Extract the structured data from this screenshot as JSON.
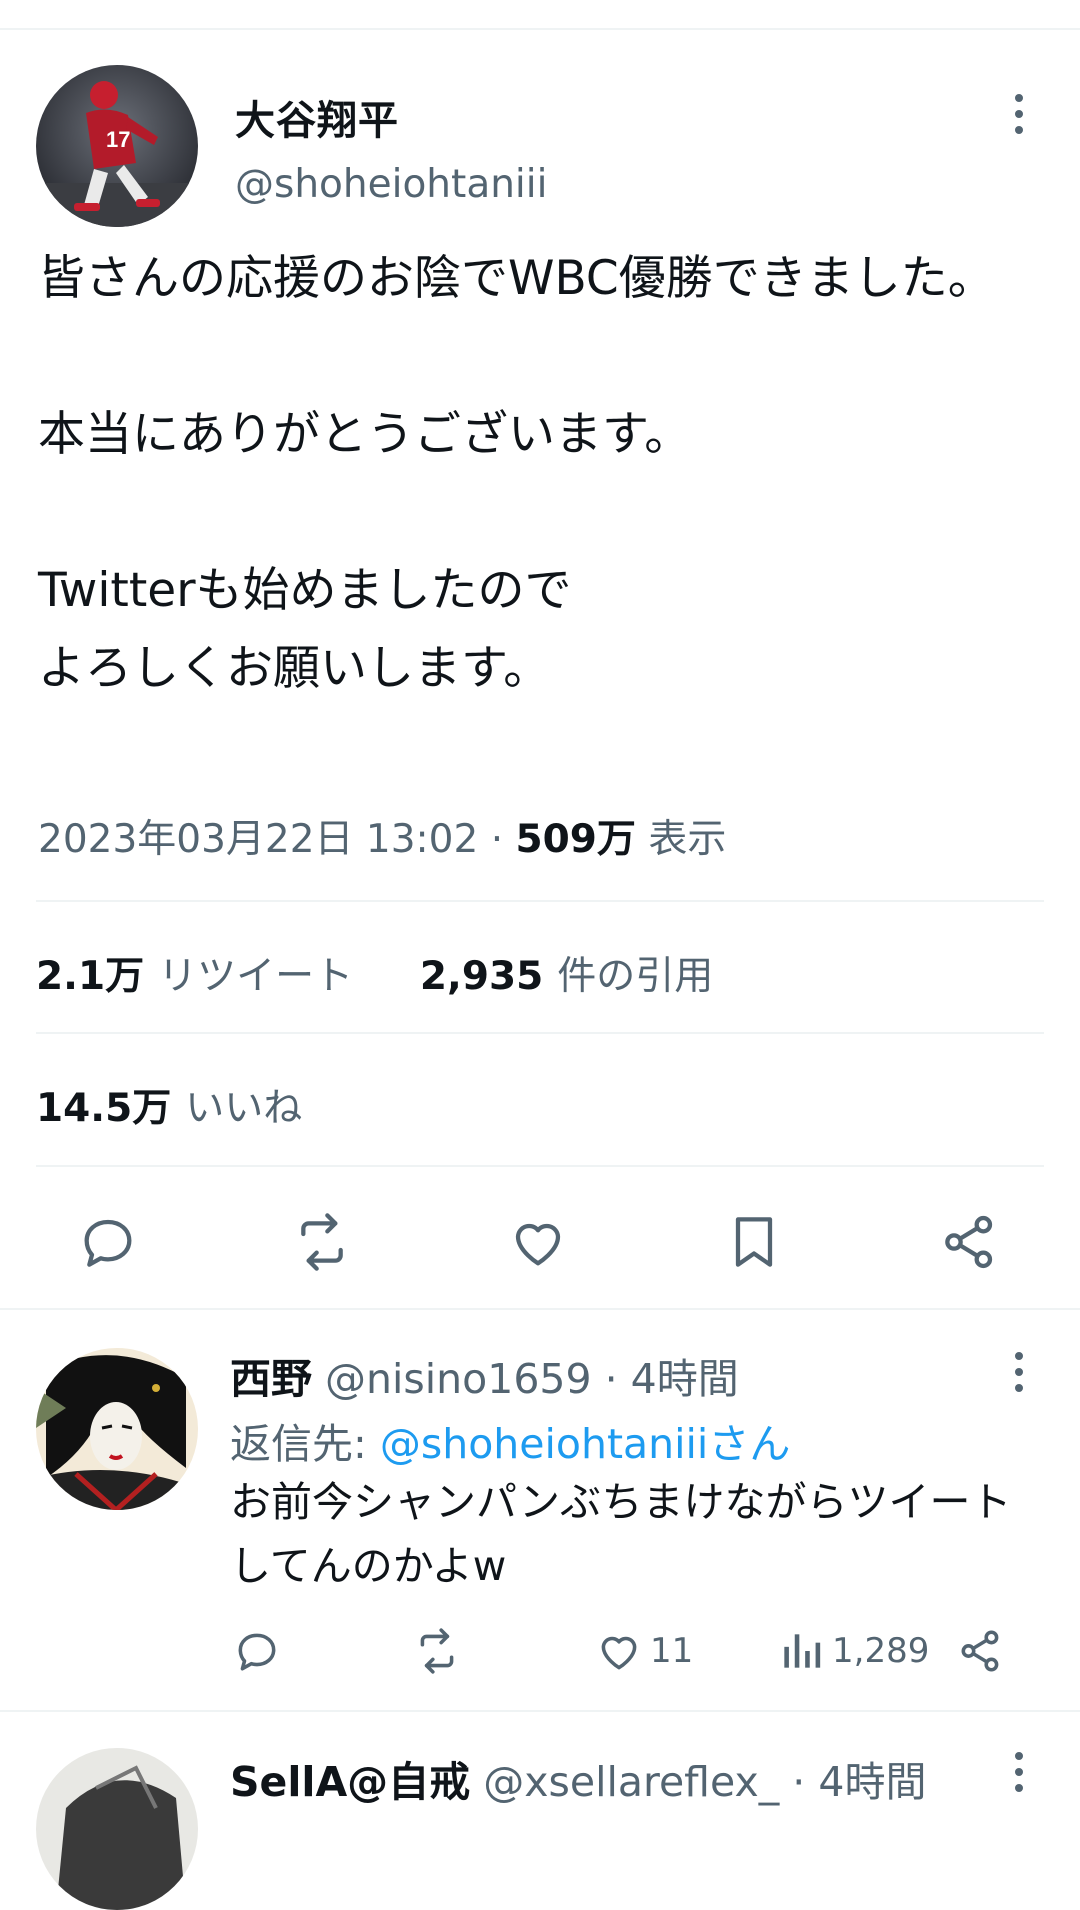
{
  "main_tweet": {
    "author_name": "大谷翔平",
    "author_handle": "@shoheiohtaniii",
    "text": "皆さんの応援のお陰でWBC優勝できました。\n\n本当にありがとうございます。\n\nTwitterも始めましたので\nよろしくお願いします。",
    "timestamp": "2023年03月22日 13:02",
    "separator": "·",
    "views_count": "509万",
    "views_label": "表示",
    "retweets_count": "2.1万",
    "retweets_label": "リツイート",
    "quotes_count": "2,935",
    "quotes_label": "件の引用",
    "likes_count": "14.5万",
    "likes_label": "いいね",
    "actions": [
      "reply-icon",
      "retweet-icon",
      "like-icon",
      "bookmark-icon",
      "share-icon"
    ]
  },
  "replies": [
    {
      "name": "西野",
      "handle_time": "@nisino1659 · 4時間",
      "reply_to_prefix": "返信先: ",
      "reply_to_handle": "@shoheiohtaniiiさん",
      "text": "お前今シャンパンぶちまけながらツイートしてんのかよw",
      "likes": "11",
      "views": "1,289"
    },
    {
      "name": "SellA@自戒",
      "handle_time": "@xsellareflex_ · 4時間"
    }
  ],
  "colors": {
    "text": "#0f1419",
    "secondary": "#536471",
    "link": "#1d9bf0",
    "divider": "#eff3f4"
  }
}
